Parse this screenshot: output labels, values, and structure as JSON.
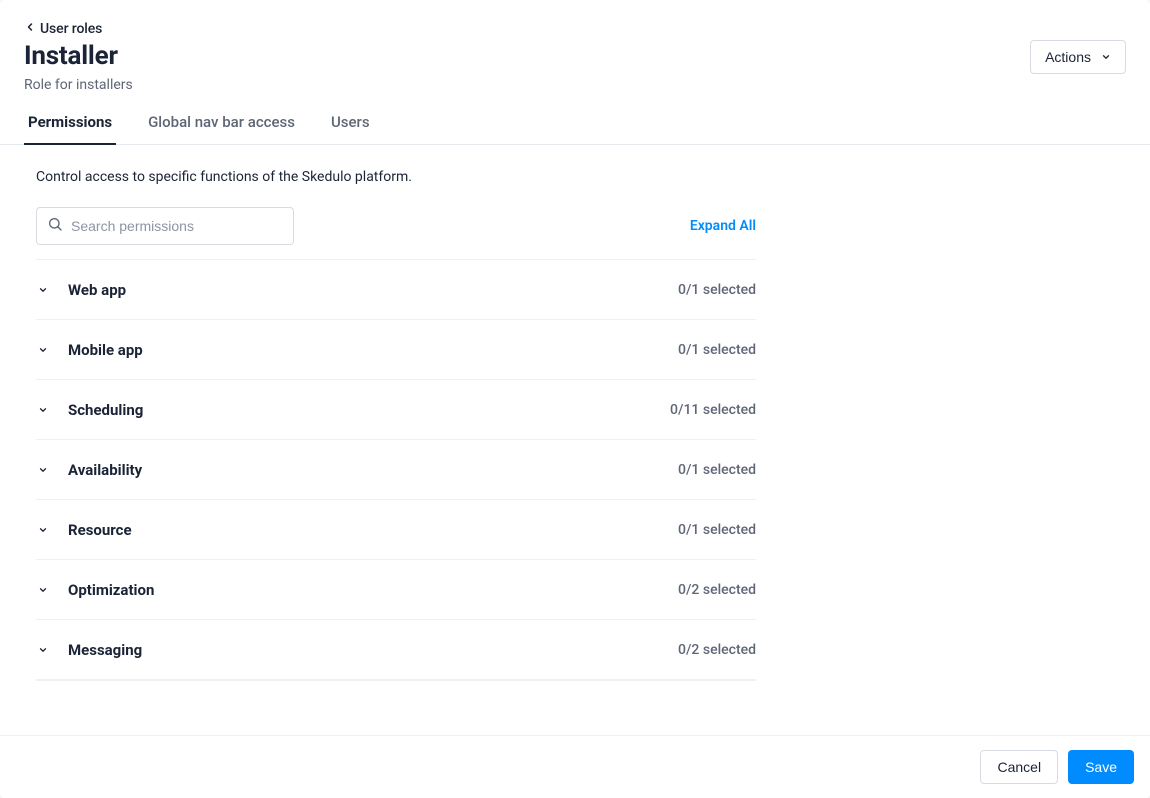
{
  "breadcrumb": {
    "label": "User roles"
  },
  "page": {
    "title": "Installer",
    "subtitle": "Role for installers"
  },
  "actions_button": {
    "label": "Actions"
  },
  "tabs": [
    {
      "label": "Permissions",
      "active": true
    },
    {
      "label": "Global nav bar access",
      "active": false
    },
    {
      "label": "Users",
      "active": false
    }
  ],
  "intro": "Control access to specific functions of the Skedulo platform.",
  "search": {
    "placeholder": "Search permissions"
  },
  "expand_all": "Expand All",
  "groups": [
    {
      "name": "Web app",
      "count": "0/1 selected"
    },
    {
      "name": "Mobile app",
      "count": "0/1 selected"
    },
    {
      "name": "Scheduling",
      "count": "0/11 selected"
    },
    {
      "name": "Availability",
      "count": "0/1 selected"
    },
    {
      "name": "Resource",
      "count": "0/1 selected"
    },
    {
      "name": "Optimization",
      "count": "0/2 selected"
    },
    {
      "name": "Messaging",
      "count": "0/2 selected"
    }
  ],
  "footer": {
    "cancel": "Cancel",
    "save": "Save"
  }
}
